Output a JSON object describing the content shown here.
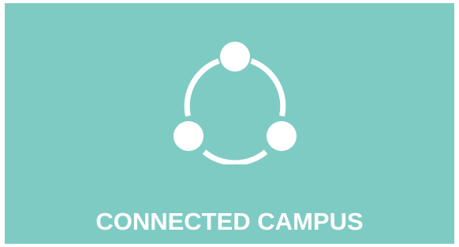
{
  "card": {
    "background": "#7ecbc4",
    "icon": "connection-network-icon",
    "icon_color": "#ffffff",
    "caption": "CONNECTED CAMPUS"
  }
}
